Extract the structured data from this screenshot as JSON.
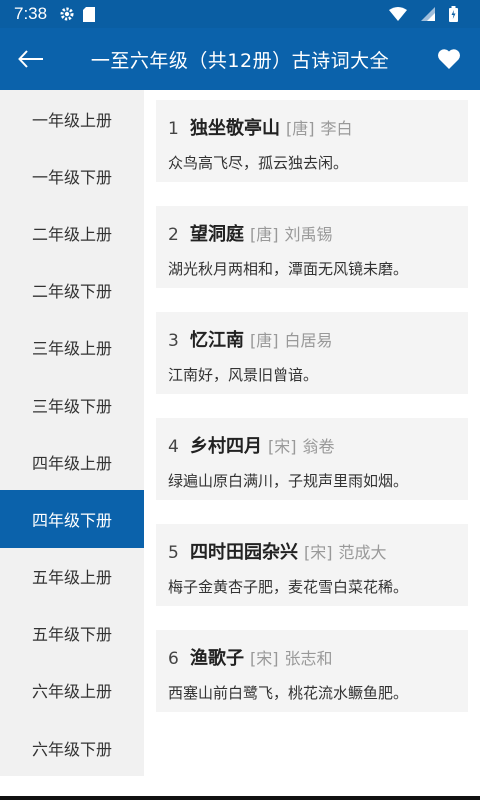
{
  "status": {
    "time": "7:38",
    "icons": [
      "gear-icon",
      "sd-card-icon",
      "wifi-icon",
      "signal-icon",
      "battery-icon"
    ]
  },
  "appbar": {
    "title": "一至六年级（共12册）古诗词大全",
    "back_icon": "arrow-left-icon",
    "fav_icon": "heart-icon",
    "color": "#0b62ab"
  },
  "sidebar": {
    "items": [
      {
        "label": "一年级上册"
      },
      {
        "label": "一年级下册"
      },
      {
        "label": "二年级上册"
      },
      {
        "label": "二年级下册"
      },
      {
        "label": "三年级上册"
      },
      {
        "label": "三年级下册"
      },
      {
        "label": "四年级上册"
      },
      {
        "label": "四年级下册"
      },
      {
        "label": "五年级上册"
      },
      {
        "label": "五年级下册"
      },
      {
        "label": "六年级上册"
      },
      {
        "label": "六年级下册"
      }
    ],
    "active_index": 7
  },
  "poems": [
    {
      "num": "1",
      "title": "独坐敬亭山",
      "dynasty": "[唐]",
      "author": "李白",
      "line": "众鸟高飞尽，孤云独去闲。"
    },
    {
      "num": "2",
      "title": "望洞庭",
      "dynasty": "[唐]",
      "author": "刘禹锡",
      "line": "湖光秋月两相和，潭面无风镜未磨。"
    },
    {
      "num": "3",
      "title": "忆江南",
      "dynasty": "[唐]",
      "author": "白居易",
      "line": "江南好，风景旧曾谙。"
    },
    {
      "num": "4",
      "title": "乡村四月",
      "dynasty": "[宋]",
      "author": "翁卷",
      "line": "绿遍山原白满川，子规声里雨如烟。"
    },
    {
      "num": "5",
      "title": "四时田园杂兴",
      "dynasty": "[宋]",
      "author": "范成大",
      "line": "梅子金黄杏子肥，麦花雪白菜花稀。"
    },
    {
      "num": "6",
      "title": "渔歌子",
      "dynasty": "[宋]",
      "author": "张志和",
      "line": "西塞山前白鹭飞，桃花流水鳜鱼肥。"
    }
  ]
}
